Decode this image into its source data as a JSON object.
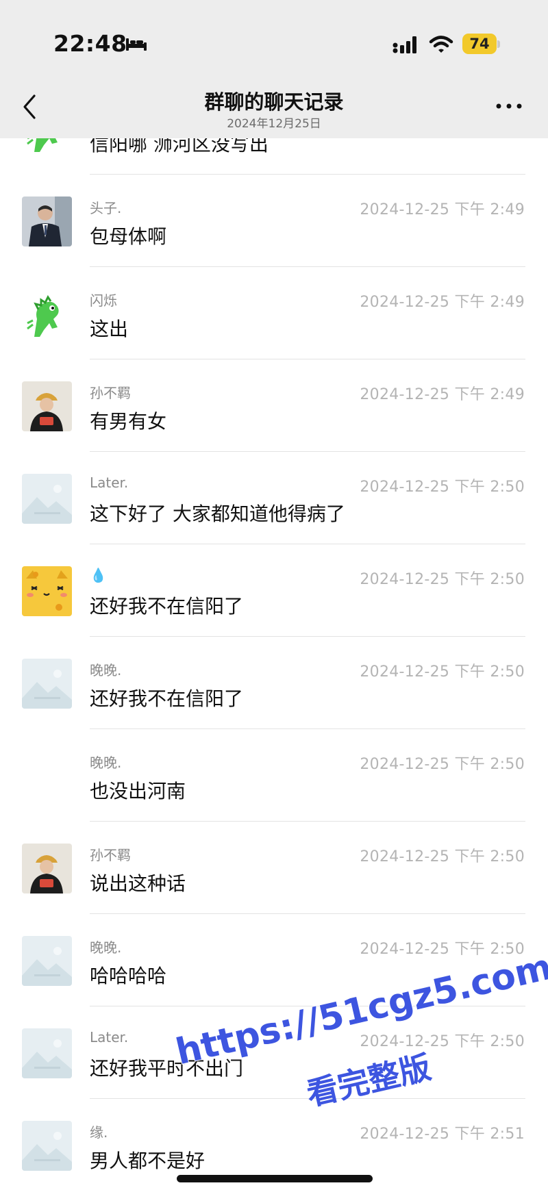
{
  "status_bar": {
    "time": "22:48",
    "battery": "74",
    "battery_color": "#f2c92b"
  },
  "nav": {
    "title": "群聊的聊天记录",
    "subtitle": "2024年12月25日"
  },
  "messages": [
    {
      "sender": "",
      "time": "",
      "text": "信阳哪 浉河区没写出",
      "avatar": "dinosaur"
    },
    {
      "sender": "头子.",
      "time": "2024-12-25 下午 2:49",
      "text": "包母体啊",
      "avatar": "man-in-suit"
    },
    {
      "sender": "闪烁",
      "time": "2024-12-25 下午 2:49",
      "text": "这出",
      "avatar": "dinosaur"
    },
    {
      "sender": "孙不羁",
      "time": "2024-12-25 下午 2:49",
      "text": "有男有女",
      "avatar": "person-with-cap"
    },
    {
      "sender": "Later.",
      "time": "2024-12-25 下午 2:50",
      "text": "这下好了  大家都知道他得病了",
      "avatar": "placeholder"
    },
    {
      "sender": "💧",
      "time": "2024-12-25 下午 2:50",
      "text": "还好我不在信阳了",
      "avatar": "cat-pudding"
    },
    {
      "sender": "晚晚.",
      "time": "2024-12-25 下午 2:50",
      "text": "还好我不在信阳了",
      "avatar": "placeholder"
    },
    {
      "sender": "晚晚.",
      "time": "2024-12-25 下午 2:50",
      "text": "也没出河南",
      "avatar": ""
    },
    {
      "sender": "孙不羁",
      "time": "2024-12-25 下午 2:50",
      "text": "说出这种话",
      "avatar": "person-with-cap"
    },
    {
      "sender": "晚晚.",
      "time": "2024-12-25 下午 2:50",
      "text": "哈哈哈哈",
      "avatar": "placeholder"
    },
    {
      "sender": "Later.",
      "time": "2024-12-25 下午 2:50",
      "text": "还好我平时不出门",
      "avatar": "placeholder"
    },
    {
      "sender": "缘.",
      "time": "2024-12-25 下午 2:51",
      "text": "男人都不是好",
      "avatar": "placeholder"
    }
  ],
  "watermark": {
    "line1": "https://51cgz5.com",
    "line2": "看完整版",
    "color": "#3d55e0"
  },
  "colors": {
    "header_bg": "#ededed",
    "sender_gray": "#8a8a8a",
    "timestamp_gray": "#b4b4b4"
  }
}
